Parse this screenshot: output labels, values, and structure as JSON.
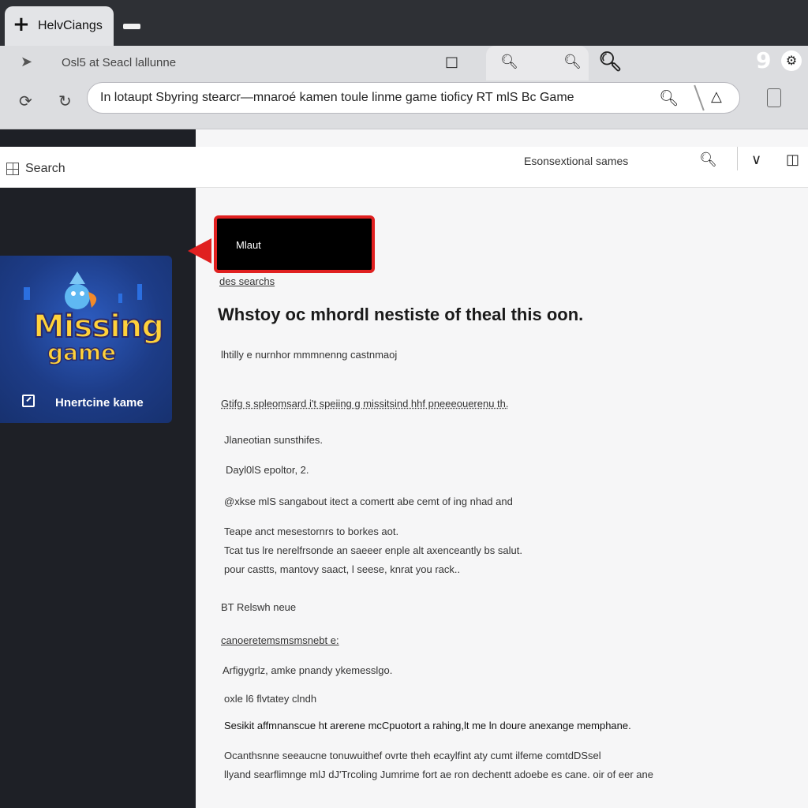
{
  "browser": {
    "tab_title": "HelvCiangs",
    "nav_title": "Osl5 at Seacl  lallunne",
    "address": "In lotaupt Sbyring stearcr—mnaroé kamen toule linme game tioficy RT mlS Bc Game"
  },
  "page": {
    "search_label": "Search",
    "header_link": "Esonsextional sames"
  },
  "sidebar": {
    "card_title_line1": "Missing",
    "card_title_line2": "game",
    "card_label": "Hnertcine kame"
  },
  "content": {
    "callout": "Mlaut",
    "link": "des searchs",
    "heading": "Whstoy oc mhordl nestiste of theal this oon.",
    "lines": [
      "lhtilly  e nurnhor mmmnenng castnmaoj",
      "Gtifg s spleomsard i't speiing g missitsind hhf pneeeouerenu th.",
      "Jlaneotian sunsthifes.",
      "Dayl0lS epoltor, 2.",
      "@xkse mlS sangabout itect a comertt abe cemt of ing nhad and",
      "Teape anct mesestornrs to borkes aot.",
      "Tcat tus lre nerelfrsonde an saeeer enple alt axenceantly bs salut.",
      "pour castts, mantovy saact, l seese, knrat you rack..",
      "BT Relswh neue",
      "canoeretemsmsmsnebt e:",
      "Arfigygrlz, amke pnandy ykemesslgo.",
      "oxle l6 flvtatey clndh",
      "Sesikit affmnanscue ht arerene mcCpuotort a rahing,lt me ln doure anexange memphane.",
      "Ocanthsnne seeaucne tonuwuithef ovrte theh ecaylfint aty cumt ilfeme comtdDSsel",
      "llyand searflimnge mlJ dJ'Trcoling Jumrime fort ae ron dechentt adoebe es cane.  oir of eer ane"
    ]
  }
}
